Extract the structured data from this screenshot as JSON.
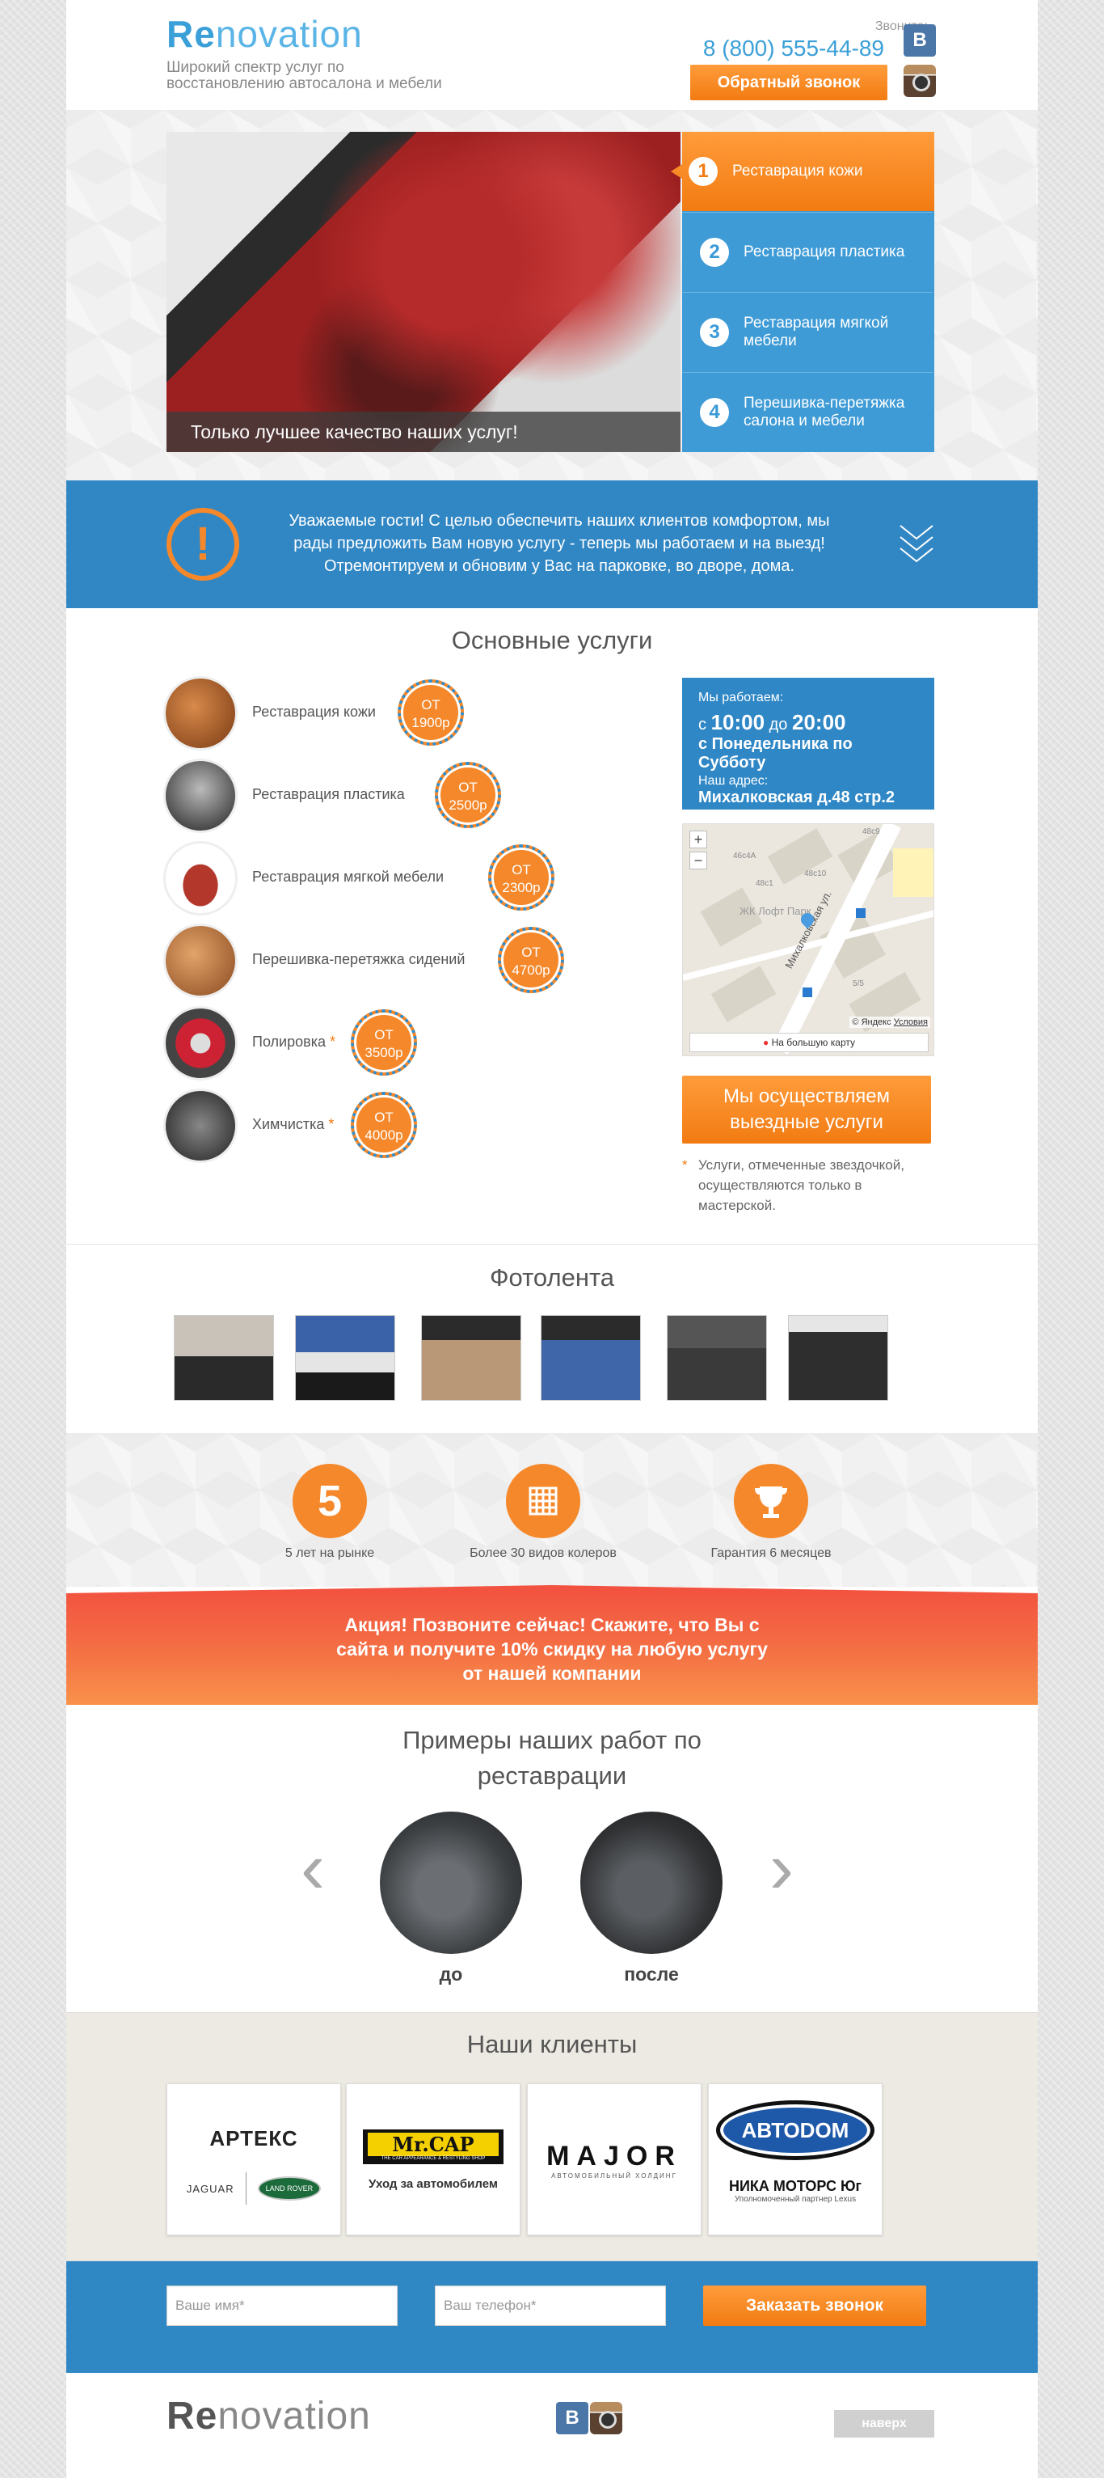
{
  "header": {
    "logo_re": "Re",
    "logo_rest": "novation",
    "tagline_1": "Широкий спектр услуг по",
    "tagline_2": "восстановлению автосалона и мебели",
    "call_label": "Звоните:",
    "phone": "8 (800) 555-44-89",
    "callback": "Обратный звонок",
    "vk": "В"
  },
  "slider": {
    "caption": "Только лучшее качество наших услуг!",
    "tabs": [
      {
        "num": "1",
        "label": "Реставрация кожи"
      },
      {
        "num": "2",
        "label": "Реставрация пластика"
      },
      {
        "num": "3",
        "label": "Реставрация мягкой мебели"
      },
      {
        "num": "4",
        "label": "Перешивка-перетяжка салона и мебели"
      }
    ]
  },
  "notice": {
    "icon": "!",
    "text": "Уважаемые гости! С целью обеспечить наших клиентов комфортом, мы рады предложить Вам новую услугу - теперь мы работаем и на выезд! Отремонтируем и обновим у Вас на парковке, во дворе, дома."
  },
  "services": {
    "title": "Основные услуги",
    "items": [
      {
        "name": "Реставрация кожи",
        "star": "",
        "price_from": "от",
        "price": "1900р"
      },
      {
        "name": "Реставрация пластика",
        "star": "",
        "price_from": "от",
        "price": "2500р"
      },
      {
        "name": "Реставрация мягкой мебели",
        "star": "",
        "price_from": "от",
        "price": "2300р"
      },
      {
        "name": "Перешивка-перетяжка сидений",
        "star": "",
        "price_from": "от",
        "price": "4700р"
      },
      {
        "name": "Полировка",
        "star": "*",
        "price_from": "от",
        "price": "3500р"
      },
      {
        "name": "Химчистка",
        "star": "*",
        "price_from": "от",
        "price": "4000р"
      }
    ]
  },
  "hours": {
    "label": "Мы работаем:",
    "prefix_from": "с",
    "from": "10:00",
    "prefix_to": "до",
    "to": "20:00",
    "days": "с Понедельника по Субботу",
    "addr_label": "Наш адрес:",
    "address": "Михалковская д.48 стр.2"
  },
  "map": {
    "zoom_in": "+",
    "zoom_out": "−",
    "street": "Михалковская ул.",
    "place": "ЖК Лофт Парк",
    "b1": "48с9",
    "b2": "46с4А",
    "b3": "48с10",
    "b4": "48с1",
    "b5": "5/5",
    "copyright": "© Яндекс",
    "terms": "Условия",
    "big_map": "На большую карту"
  },
  "outcall": {
    "button": "Мы осуществляем выездные услуги",
    "note_star": "*",
    "note": "Услуги, отмеченные звездочкой, осуществляются только в мастерской."
  },
  "photos": {
    "title": "Фотолента"
  },
  "facts": [
    {
      "icon": "5",
      "label": "5 лет на рынке"
    },
    {
      "icon": "palette",
      "label": "Более 30 видов колеров"
    },
    {
      "icon": "trophy",
      "label": "Гарантия 6 месяцев"
    }
  ],
  "promo": {
    "text": "Акция! Позвоните сейчас! Скажите, что Вы с сайта и получите 10% скидку на любую услугу от нашей компании"
  },
  "works": {
    "title": "Примеры наших работ по реставрации",
    "before": "до",
    "after": "после",
    "prev": "‹",
    "next": "›"
  },
  "clients": {
    "title": "Наши клиенты",
    "artex": "АРТЕКС",
    "jaguar": "JAGUAR",
    "landrover": "LAND ROVER",
    "mrcap": "Mr.CAP",
    "mrcap_sub": "THE CAR APPEARANCE & RESTYLING SHOP",
    "mrcap_caption": "Уход за автомобилем",
    "major": "MAJOR",
    "major_sub": "АВТОМОБИЛЬНЫЙ ХОЛДИНГ",
    "avtodom": "АВТОDОМ",
    "nika": "НИКА МОТОРС Юг",
    "nika_sub": "Уполномоченный партнер Lexus"
  },
  "form": {
    "name_placeholder": "Ваше имя*",
    "phone_placeholder": "Ваш телефон*",
    "submit": "Заказать звонок"
  },
  "footer": {
    "logo_re": "Re",
    "logo_rest": "novation",
    "vk": "В",
    "up": "наверх"
  }
}
